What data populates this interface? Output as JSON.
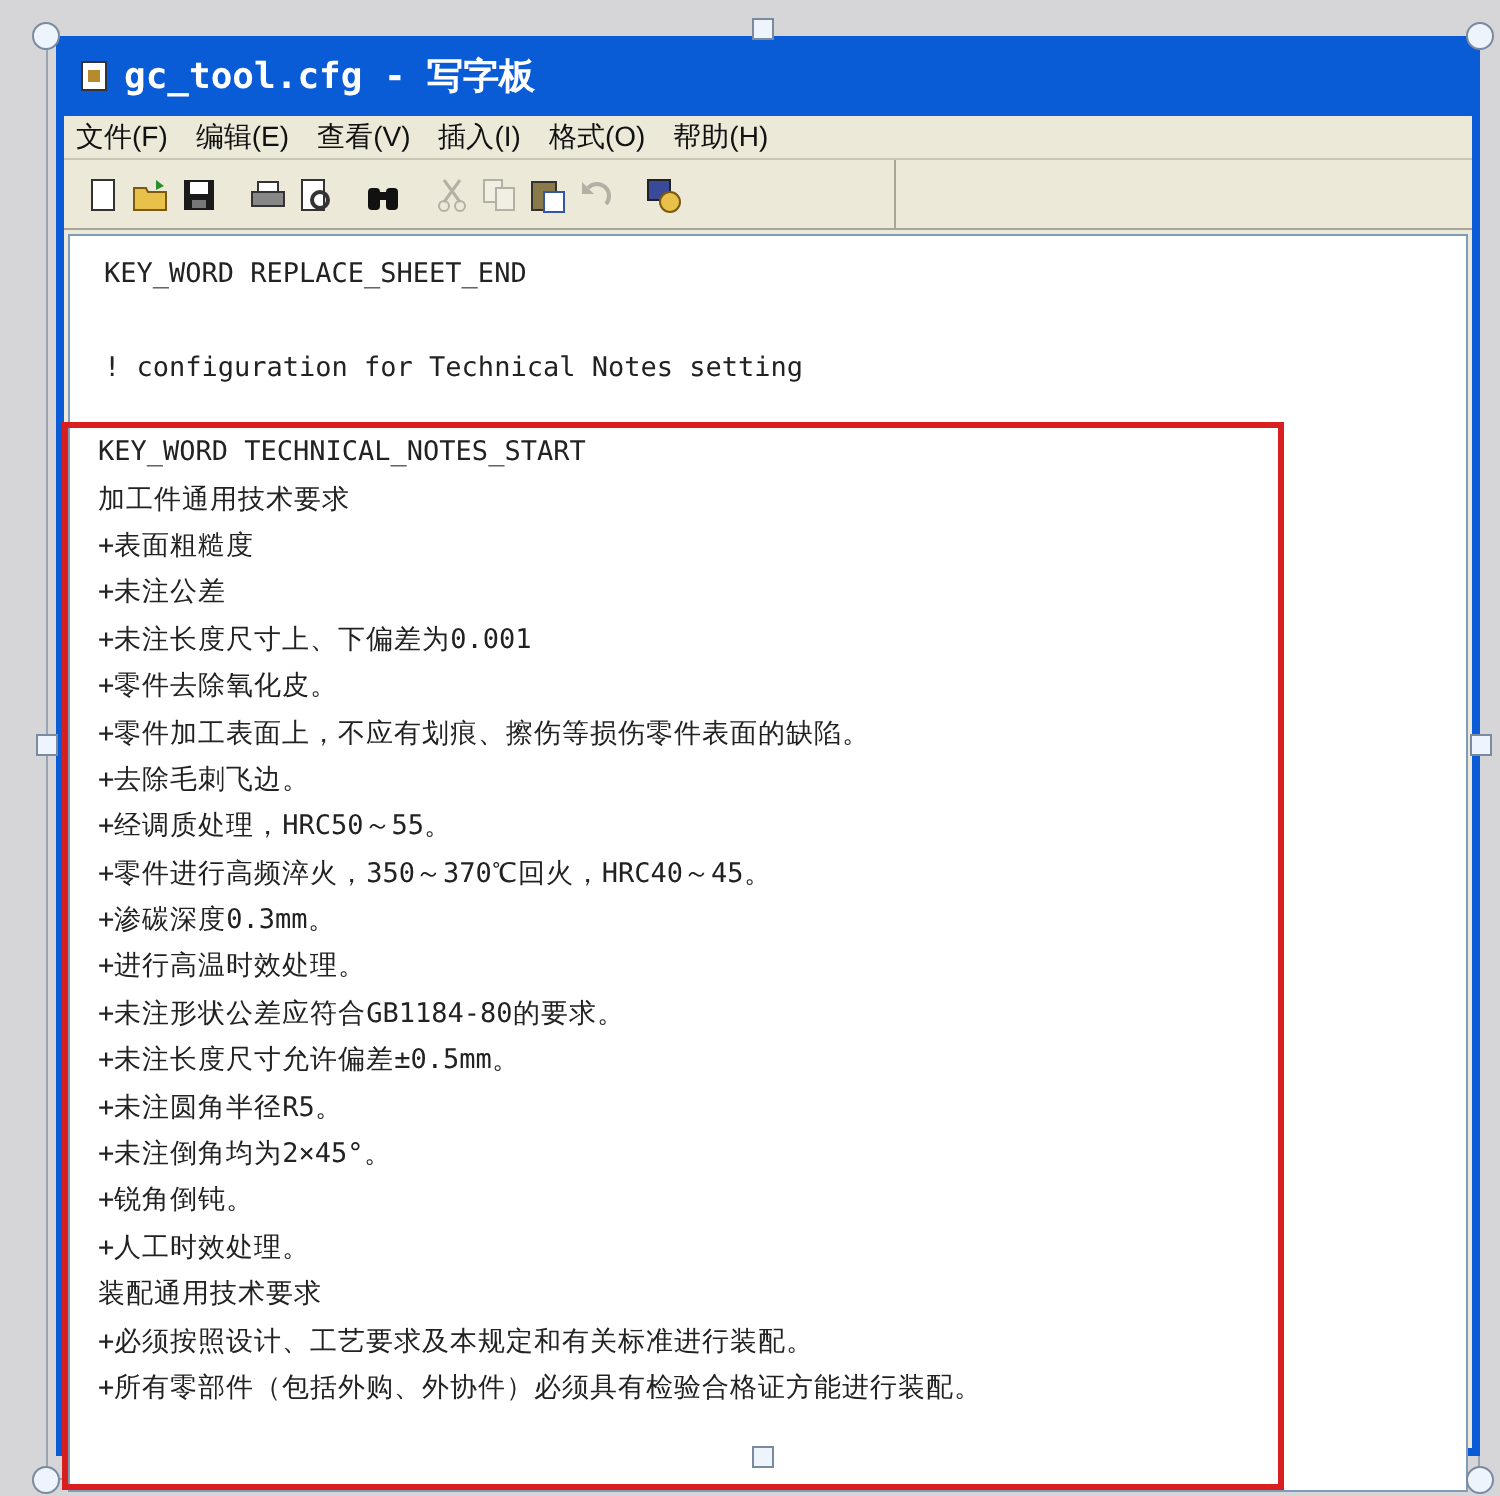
{
  "window": {
    "title": "gc_tool.cfg - 写字板"
  },
  "menu": [
    {
      "label": "文件(F)"
    },
    {
      "label": "编辑(E)"
    },
    {
      "label": "查看(V)"
    },
    {
      "label": "插入(I)"
    },
    {
      "label": "格式(O)"
    },
    {
      "label": "帮助(H)"
    }
  ],
  "toolbar": [
    {
      "kind": "new",
      "disabled": false
    },
    {
      "kind": "open",
      "disabled": false
    },
    {
      "kind": "save",
      "disabled": false
    },
    {
      "kind": "print",
      "disabled": false
    },
    {
      "kind": "preview",
      "disabled": false
    },
    {
      "kind": "find",
      "disabled": false
    },
    {
      "kind": "cut",
      "disabled": true
    },
    {
      "kind": "copy",
      "disabled": true
    },
    {
      "kind": "paste",
      "disabled": false
    },
    {
      "kind": "undo",
      "disabled": true
    },
    {
      "kind": "object",
      "disabled": false
    }
  ],
  "document": {
    "blocks": [
      {
        "highlighted": false,
        "lines": [
          "KEY_WORD REPLACE_SHEET_END"
        ]
      },
      {
        "highlighted": false,
        "lines": [
          "! configuration for Technical Notes setting"
        ]
      },
      {
        "highlighted": true,
        "lines": [
          "KEY_WORD TECHNICAL_NOTES_START",
          "加工件通用技术要求",
          "+表面粗糙度",
          "+未注公差",
          "+未注长度尺寸上、下偏差为0.001",
          "+零件去除氧化皮。",
          "+零件加工表面上，不应有划痕、擦伤等损伤零件表面的缺陷。",
          "+去除毛刺飞边。",
          "+经调质处理，HRC50～55。",
          "+零件进行高频淬火，350～370℃回火，HRC40～45。",
          "+渗碳深度0.3mm。",
          "+进行高温时效处理。",
          "+未注形状公差应符合GB1184-80的要求。",
          "+未注长度尺寸允许偏差±0.5mm。",
          "+未注圆角半径R5。",
          "+未注倒角均为2×45°。",
          "+锐角倒钝。",
          "+人工时效处理。",
          "装配通用技术要求",
          "+必须按照设计、工艺要求及本规定和有关标准进行装配。",
          "+所有零部件（包括外购、外协件）必须具有检验合格证方能进行装配。"
        ]
      }
    ]
  }
}
